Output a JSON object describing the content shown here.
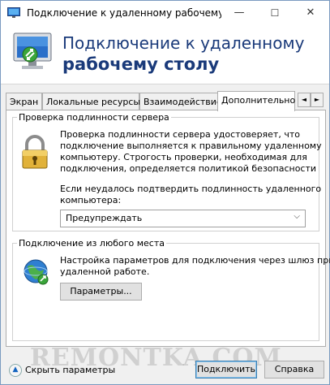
{
  "window": {
    "title": "Подключение к удаленному рабочему с...",
    "minimize": "—",
    "maximize": "☐",
    "close": "✕"
  },
  "header": {
    "line1": "Подключение к удаленному",
    "line2": "рабочему столу"
  },
  "tabs": [
    {
      "label": "Экран"
    },
    {
      "label": "Локальные ресурсы"
    },
    {
      "label": "Взаимодействие"
    },
    {
      "label": "Дополнительно"
    }
  ],
  "tab_scroll": {
    "left": "◄",
    "right": "►"
  },
  "server_auth": {
    "legend": "Проверка подлинности сервера",
    "desc_lines": [
      "Проверка подлинности сервера удостоверяет, что",
      "подключение выполняется к правильному удаленному",
      "компьютеру. Строгость проверки, необходимая для",
      "подключения, определяется политикой безопасности"
    ],
    "question_lines": [
      "Если неудалось подтвердить подлинность удаленного",
      "компьютера:"
    ],
    "select_value": "Предупреждать"
  },
  "anywhere": {
    "legend": "Подключение из любого места",
    "desc_lines": [
      "Настройка параметров для подключения через шлюз при",
      "удаленной работе."
    ],
    "params_button": "Параметры..."
  },
  "footer": {
    "toggle_label": "Скрыть параметры",
    "connect_button": "Подключить",
    "help_button": "Справка"
  },
  "watermark": "REMONTKA.COM"
}
